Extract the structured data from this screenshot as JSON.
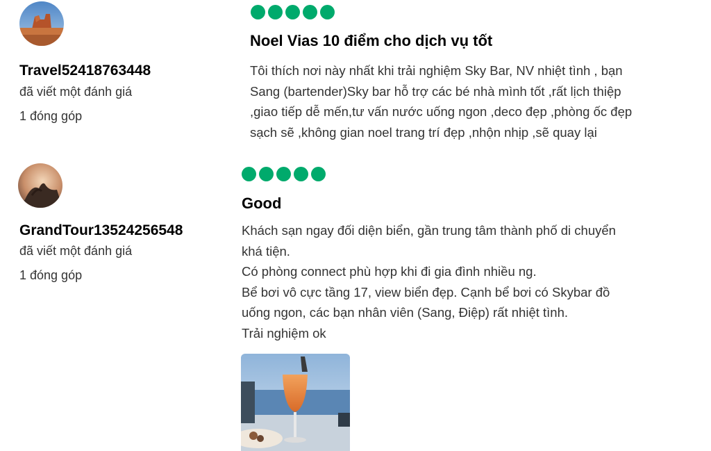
{
  "reviews": [
    {
      "username": "Travel52418763448",
      "written": "đã viết một đánh giá",
      "contributions": "1 đóng góp",
      "rating": 5,
      "title": "Noel Vias 10 điểm cho dịch vụ tốt",
      "body_lines": [
        "Tôi thích nơi này nhất khi trải nghiệm Sky Bar, NV nhiệt tình , bạn",
        "Sang (bartender)Sky bar hỗ  trợ các bé nhà mình tốt ,rất lịch thiệp",
        ",giao tiếp dễ mến,tư vấn nước uống ngon ,deco đẹp ,phòng ốc đẹp",
        "sạch sẽ ,không gian noel trang trí đẹp ,nhộn nhịp ,sẽ quay lại"
      ],
      "bubble_color": "#00aa6c"
    },
    {
      "username": "GrandTour13524256548",
      "written": "đã viết một đánh giá",
      "contributions": "1 đóng góp",
      "rating": 5,
      "title": "Good",
      "body_lines": [
        "Khách sạn ngay đối diện biển, gần trung tâm thành phố di chuyển",
        "khá tiện.",
        "Có phòng connect phù hợp khi đi gia đình nhiều ng.",
        "Bể bơi vô cực tầng 17, view biển đẹp. Cạnh bể bơi có Skybar đồ",
        "uống ngon, các bạn nhân viên (Sang, Điệp) rất nhiệt tình.",
        "Trải nghiệm  ok"
      ],
      "bubble_color": "#00aa6c"
    }
  ]
}
